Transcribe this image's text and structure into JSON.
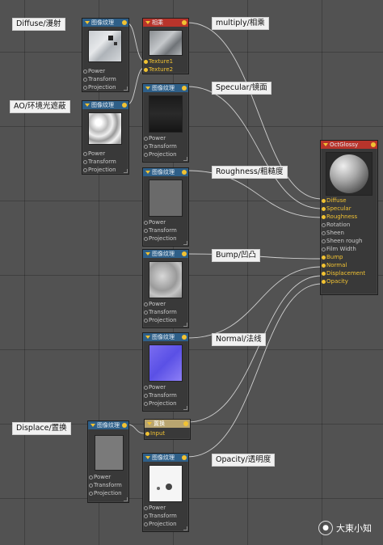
{
  "colors": {
    "accent": "#2e5f88",
    "wire": "#d9d9d9",
    "port_yellow": "#f1c232",
    "output_header": "#b8342b"
  },
  "labels": {
    "diffuse": "Diffuse/漫射",
    "ao": "AO/环境光遮蔽",
    "multiply": "multiply/相乘",
    "specular": "Specular/镜面",
    "roughness": "Roughness/粗糙度",
    "bump": "Bump/凹凸",
    "normal": "Normal/法线",
    "displace": "Displace/置换",
    "opacity": "Opacity/透明度"
  },
  "nodes": {
    "image_texture_title": "图像纹理",
    "multiply_title": "相乘",
    "displace_title": "置换",
    "material_title": "OctGlossy",
    "texture_ports": [
      "Power",
      "Transform",
      "Projection"
    ],
    "multiply_ports": [
      "Texture1",
      "Texture2"
    ],
    "displace_ports": [
      "Input"
    ],
    "material_ports": [
      "Diffuse",
      "Specular",
      "Roughness",
      "Rotation",
      "Sheen",
      "Sheen rough",
      "Film Width",
      "Bump",
      "Normal",
      "Displacement",
      "Opacity"
    ]
  },
  "watermark": {
    "icon": "wechat-icon",
    "text": "大東小知"
  }
}
